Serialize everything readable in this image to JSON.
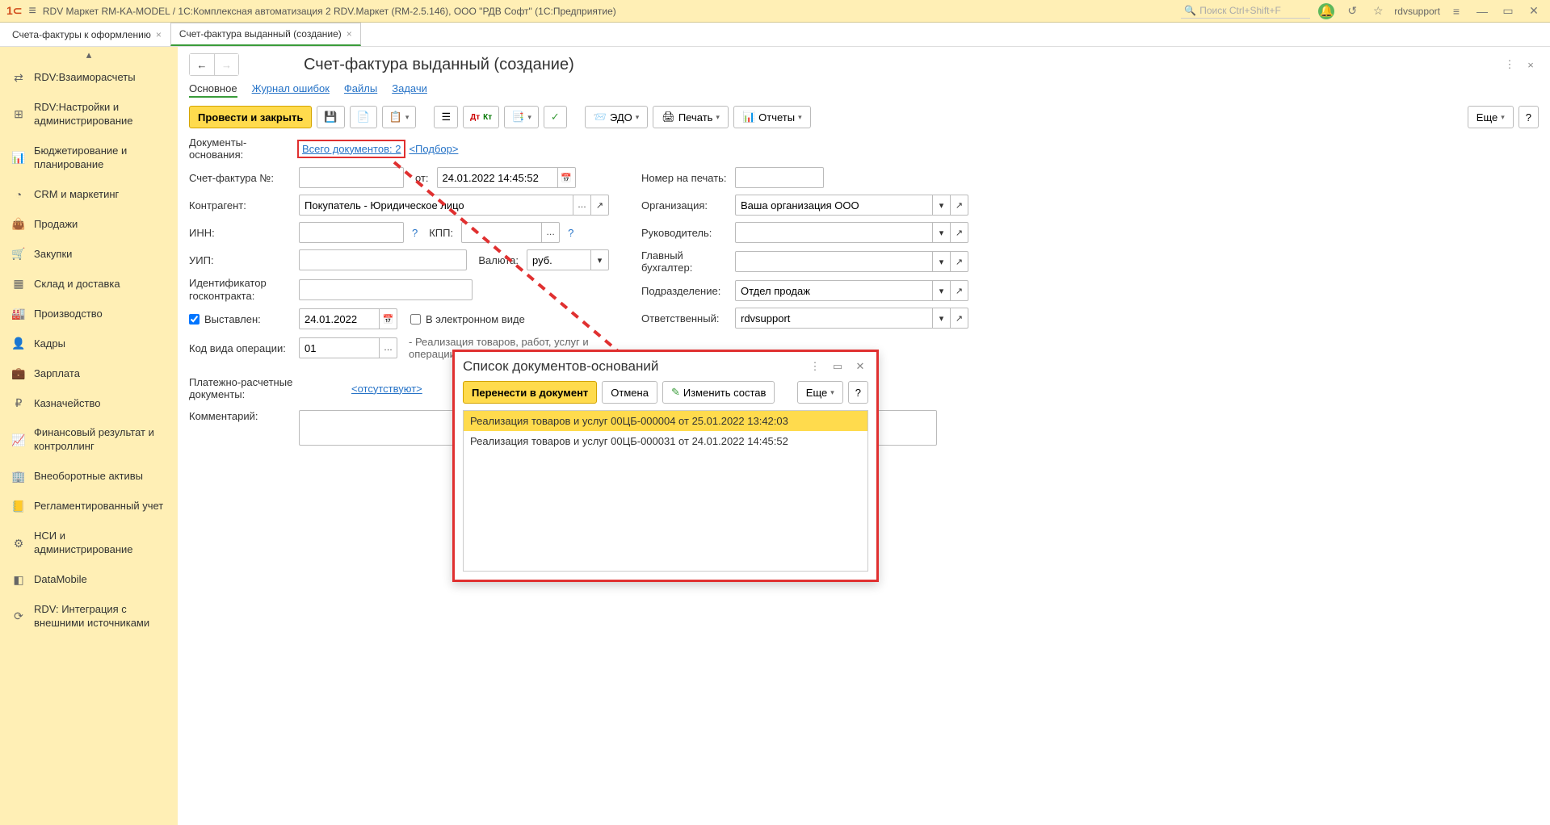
{
  "topbar": {
    "app_title": "RDV Маркет RM-KA-MODEL / 1С:Комплексная автоматизация 2 RDV.Маркет (RM-2.5.146), ООО \"РДВ Софт\" (1С:Предприятие)",
    "search_placeholder": "Поиск Ctrl+Shift+F",
    "user": "rdvsupport"
  },
  "tabs": [
    {
      "label": "Счета-фактуры к оформлению"
    },
    {
      "label": "Счет-фактура выданный (создание)"
    }
  ],
  "sidebar": [
    {
      "icon": "⇄",
      "label": "RDV:Взаиморасчеты"
    },
    {
      "icon": "⊞",
      "label": "RDV:Настройки и администрирование"
    },
    {
      "icon": "📊",
      "label": "Бюджетирование и планирование"
    },
    {
      "icon": "◔",
      "label": "CRM и маркетинг"
    },
    {
      "icon": "👜",
      "label": "Продажи"
    },
    {
      "icon": "🛒",
      "label": "Закупки"
    },
    {
      "icon": "▦",
      "label": "Склад и доставка"
    },
    {
      "icon": "🏭",
      "label": "Производство"
    },
    {
      "icon": "👤",
      "label": "Кадры"
    },
    {
      "icon": "💼",
      "label": "Зарплата"
    },
    {
      "icon": "₽",
      "label": "Казначейство"
    },
    {
      "icon": "📈",
      "label": "Финансовый результат и контроллинг"
    },
    {
      "icon": "🏢",
      "label": "Внеоборотные активы"
    },
    {
      "icon": "📒",
      "label": "Регламентированный учет"
    },
    {
      "icon": "⚙",
      "label": "НСИ и администрирование"
    },
    {
      "icon": "◧",
      "label": "DataMobile"
    },
    {
      "icon": "⟳",
      "label": "RDV: Интеграция с внешними источниками"
    }
  ],
  "page": {
    "title": "Счет-фактура выданный (создание)",
    "subnav": {
      "main": "Основное",
      "errors": "Журнал ошибок",
      "files": "Файлы",
      "tasks": "Задачи"
    },
    "toolbar": {
      "submit": "Провести и закрыть",
      "edo": "ЭДО",
      "print": "Печать",
      "reports": "Отчеты",
      "more": "Еще"
    },
    "basis_label": "Документы-основания:",
    "basis_link": "Всего документов: 2",
    "basis_select": "<Подбор>",
    "labels": {
      "sf_no": "Счет-фактура №:",
      "from": "от:",
      "print_no": "Номер на печать:",
      "counterparty": "Контрагент:",
      "org": "Организация:",
      "inn": "ИНН:",
      "kpp": "КПП:",
      "head": "Руководитель:",
      "uip": "УИП:",
      "currency": "Валюта:",
      "accountant": "Главный бухгалтер:",
      "contract_id": "Идентификатор госконтракта:",
      "dept": "Подразделение:",
      "issued": "Выставлен:",
      "electronic": "В электронном виде",
      "responsible": "Ответственный:",
      "op_code": "Код вида операции:",
      "op_desc": "- Реализация товаров, работ, услуг и операции, приравненные к ней",
      "pay_docs": "Платежно-расчетные документы:",
      "pay_absent": "<отсутствуют>",
      "comment": "Комментарий:"
    },
    "values": {
      "date": "24.01.2022 14:45:52",
      "counterparty": "Покупатель - Юридическое лицо",
      "org": "Ваша организация ООО",
      "currency": "руб.",
      "dept": "Отдел продаж",
      "issued_date": "24.01.2022",
      "responsible": "rdvsupport",
      "op_code": "01"
    }
  },
  "popup": {
    "title": "Список документов-оснований",
    "transfer": "Перенести в документ",
    "cancel": "Отмена",
    "edit": "Изменить состав",
    "more": "Еще",
    "rows": [
      "Реализация товаров и услуг 00ЦБ-000004 от 25.01.2022 13:42:03",
      "Реализация товаров и услуг 00ЦБ-000031 от 24.01.2022 14:45:52"
    ]
  }
}
